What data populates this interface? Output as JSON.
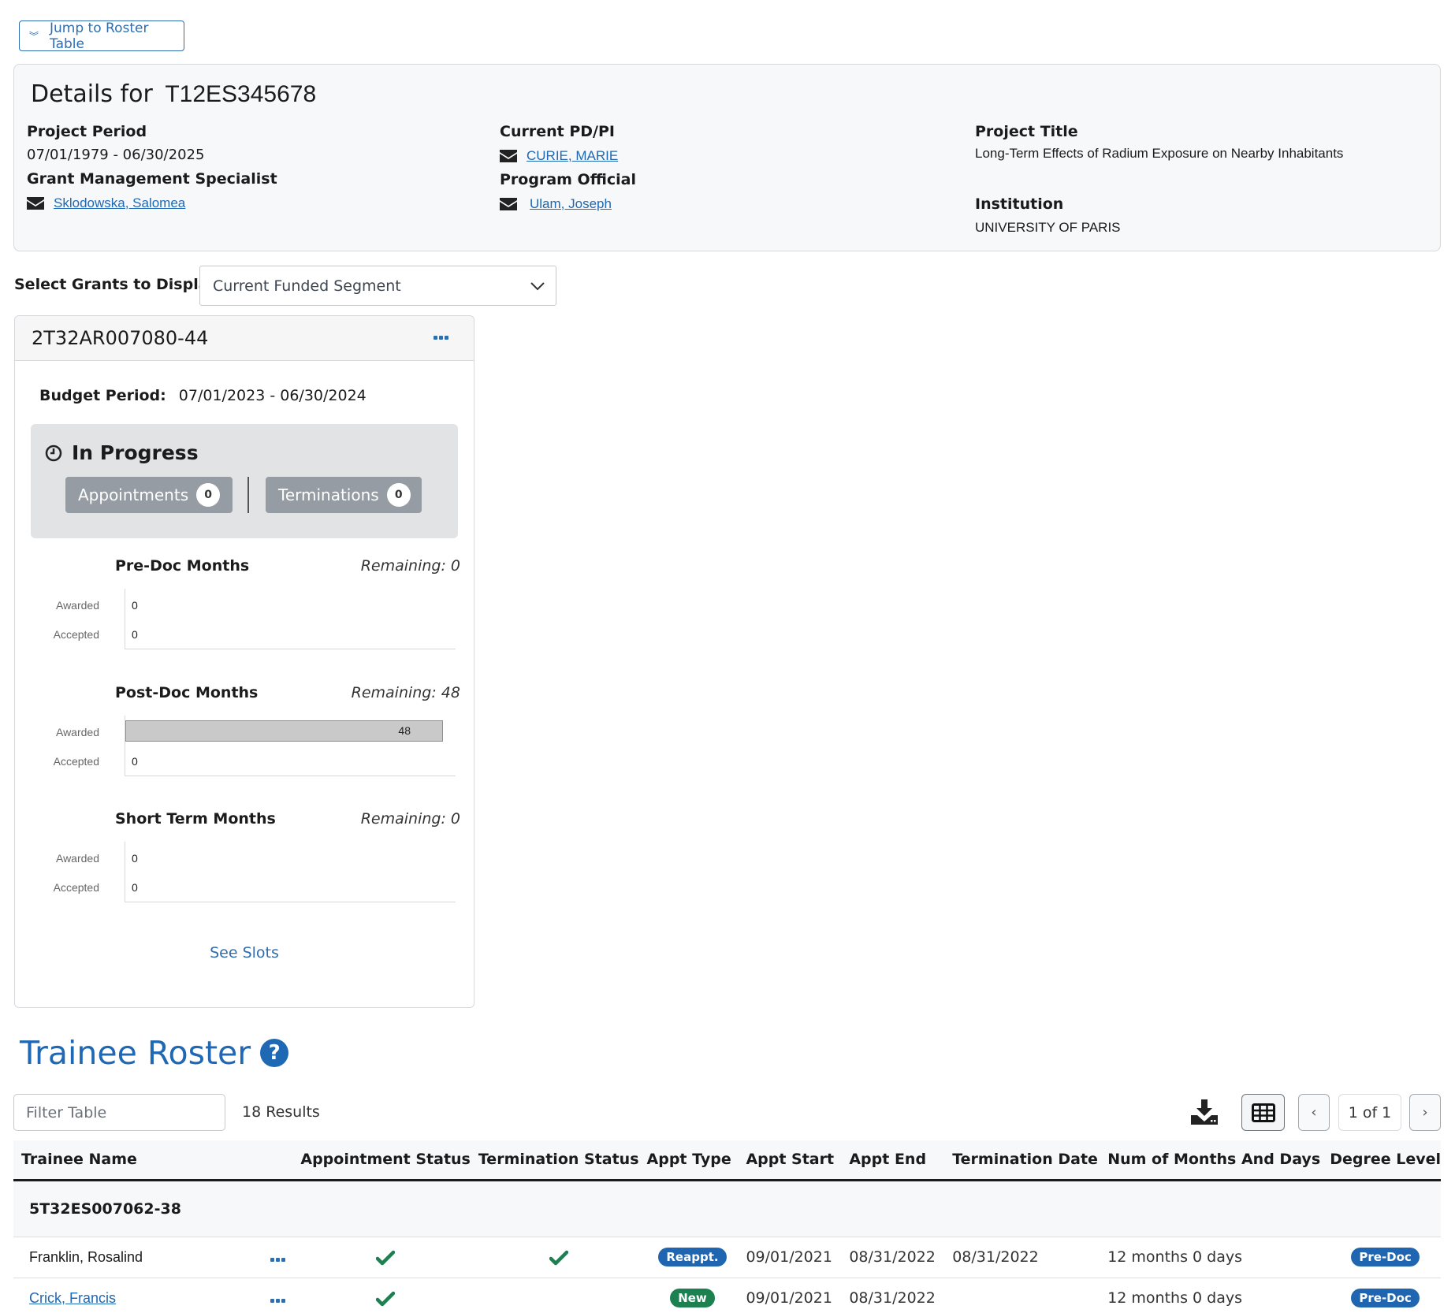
{
  "jump_button": {
    "label": "Jump to Roster Table",
    "icon": "double-chevron-down-icon"
  },
  "details": {
    "title_prefix": "Details for",
    "grant_id": "T12ES345678",
    "project_period": {
      "label": "Project Period",
      "value": "07/01/1979 - 06/30/2025"
    },
    "gms": {
      "label": "Grant Management Specialist",
      "name": "Sklodowska, Salomea",
      "icon": "envelope-icon"
    },
    "pdpi": {
      "label": "Current PD/PI",
      "name": "CURIE, MARIE",
      "icon": "envelope-icon"
    },
    "program_official": {
      "label": "Program Official",
      "name": "Ulam, Joseph",
      "icon": "envelope-icon"
    },
    "project_title": {
      "label": "Project Title",
      "value": "Long-Term Effects of Radium Exposure on Nearby Inhabitants"
    },
    "institution": {
      "label": "Institution",
      "value": "UNIVERSITY OF PARIS"
    }
  },
  "grant_select": {
    "label": "Select Grants to Display",
    "selected": "Current Funded Segment"
  },
  "grant_card": {
    "grant_id": "2T32AR007080-44",
    "budget_label": "Budget Period:",
    "budget_value": "07/01/2023 - 06/30/2024",
    "in_progress": {
      "title": "In Progress",
      "appointments_label": "Appointments",
      "appointments_count": "0",
      "terminations_label": "Terminations",
      "terminations_count": "0"
    },
    "awarded_label": "Awarded",
    "accepted_label": "Accepted",
    "months": [
      {
        "title": "Pre-Doc Months",
        "remaining": "Remaining: 0",
        "awarded": 0,
        "accepted": 0
      },
      {
        "title": "Post-Doc Months",
        "remaining": "Remaining: 48",
        "awarded": 48,
        "accepted": 0
      },
      {
        "title": "Short Term Months",
        "remaining": "Remaining: 0",
        "awarded": 0,
        "accepted": 0
      }
    ],
    "see_slots": "See Slots"
  },
  "roster": {
    "title": "Trainee Roster",
    "filter_placeholder": "Filter Table",
    "results": "18 Results",
    "pagination": {
      "prev": "‹",
      "current": "1 of 1",
      "next": "›"
    },
    "columns": [
      "Trainee Name",
      "",
      "Appointment Status",
      "Termination Status",
      "Appt Type",
      "Appt Start",
      "Appt End",
      "Termination Date",
      "Num of Months And Days",
      "Degree Level"
    ],
    "group": "5T32ES007062-38",
    "rows": [
      {
        "name": "Franklin, Rosalind",
        "name_is_link": false,
        "appointment_status": "complete",
        "termination_status": "complete",
        "appt_type": "Reappt.",
        "appt_type_color": "#2065b0",
        "appt_start": "09/01/2021",
        "appt_end": "08/31/2022",
        "termination_date": "08/31/2022",
        "months_days": "12 months 0 days",
        "degree_level": "Pre-Doc"
      },
      {
        "name": "Crick, Francis",
        "name_is_link": true,
        "appointment_status": "complete",
        "termination_status": "",
        "appt_type": "New",
        "appt_type_color": "#1c8050",
        "appt_start": "09/01/2021",
        "appt_end": "08/31/2022",
        "termination_date": "",
        "months_days": "12 months 0 days",
        "degree_level": "Pre-Doc"
      }
    ]
  },
  "colors": {
    "link": "#1f68b3",
    "success": "#1c8050",
    "badge_blue": "#2065b0"
  }
}
